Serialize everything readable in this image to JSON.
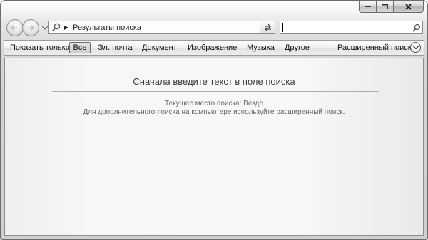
{
  "window": {
    "caption_buttons": [
      "minimize-icon",
      "maximize-icon",
      "close-icon"
    ]
  },
  "navigation": {
    "back_icon": "back-arrow-icon",
    "forward_icon": "forward-arrow-icon",
    "recent_icon": "chevron-down-icon"
  },
  "address_bar": {
    "icon": "search-icon",
    "path": "Результаты поиска",
    "refresh_icon": "refresh-icon"
  },
  "search": {
    "value": "",
    "icon": "search-icon"
  },
  "filter_bar": {
    "label": "Показать только:",
    "options": [
      "Все",
      "Эл. почта",
      "Документ",
      "Изображение",
      "Музыка",
      "Другое"
    ],
    "selected": "Все",
    "advanced_label": "Расширенный поиск",
    "advanced_icon": "chevron-down-circle-icon"
  },
  "content": {
    "heading": "Сначала введите текст в поле поиска",
    "location": "Текущее место поиска: Везде",
    "hint": "Для дополнительного поиска на компьютере используйте расширенный поиск."
  },
  "colors": {
    "frame": "#d6d6d6",
    "content_bg": "#f7f7f7",
    "heading_text": "#3a3a3a",
    "hint_text": "#666666"
  }
}
